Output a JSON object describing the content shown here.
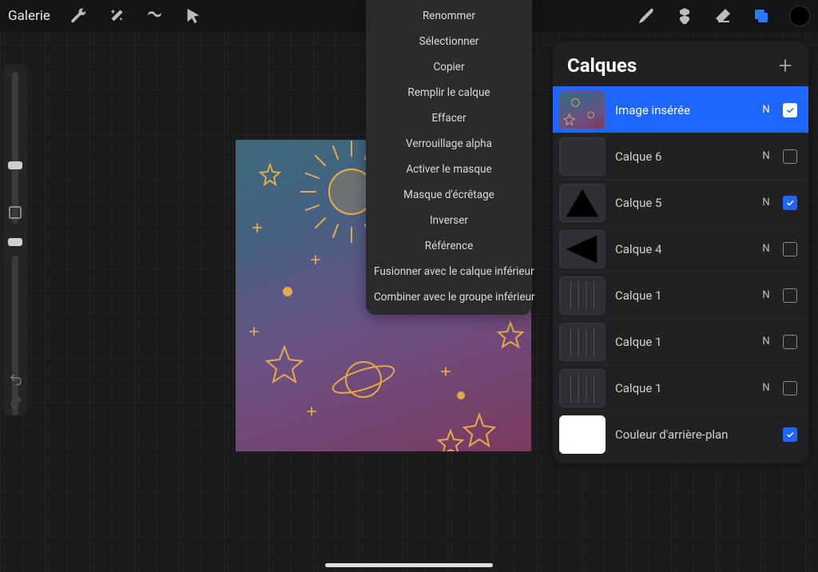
{
  "topbar": {
    "gallery": "Galerie"
  },
  "context_menu": {
    "items": [
      "Renommer",
      "Sélectionner",
      "Copier",
      "Remplir le calque",
      "Effacer",
      "Verrouillage alpha",
      "Activer le masque",
      "Masque d'écrêtage",
      "Inverser",
      "Référence",
      "Fusionner avec le calque inférieur",
      "Combiner avec le groupe inférieur"
    ]
  },
  "layers_panel": {
    "title": "Calques",
    "blend_normal": "N",
    "layers": [
      {
        "name": "Image insérée",
        "blend": "N",
        "visible": true,
        "selected": true
      },
      {
        "name": "Calque 6",
        "blend": "N",
        "visible": false,
        "selected": false
      },
      {
        "name": "Calque 5",
        "blend": "N",
        "visible": true,
        "selected": false
      },
      {
        "name": "Calque 4",
        "blend": "N",
        "visible": false,
        "selected": false
      },
      {
        "name": "Calque 1",
        "blend": "N",
        "visible": false,
        "selected": false
      },
      {
        "name": "Calque 1",
        "blend": "N",
        "visible": false,
        "selected": false
      },
      {
        "name": "Calque 1",
        "blend": "N",
        "visible": false,
        "selected": false
      }
    ],
    "background": {
      "name": "Couleur d'arrière-plan",
      "visible": true
    }
  },
  "colors": {
    "accent": "#1f66ff",
    "canvas_gradient": [
      "#3b6b7a",
      "#456182",
      "#6a5185",
      "#7a3a5e"
    ],
    "doodle_stroke": "#e5a94a"
  }
}
